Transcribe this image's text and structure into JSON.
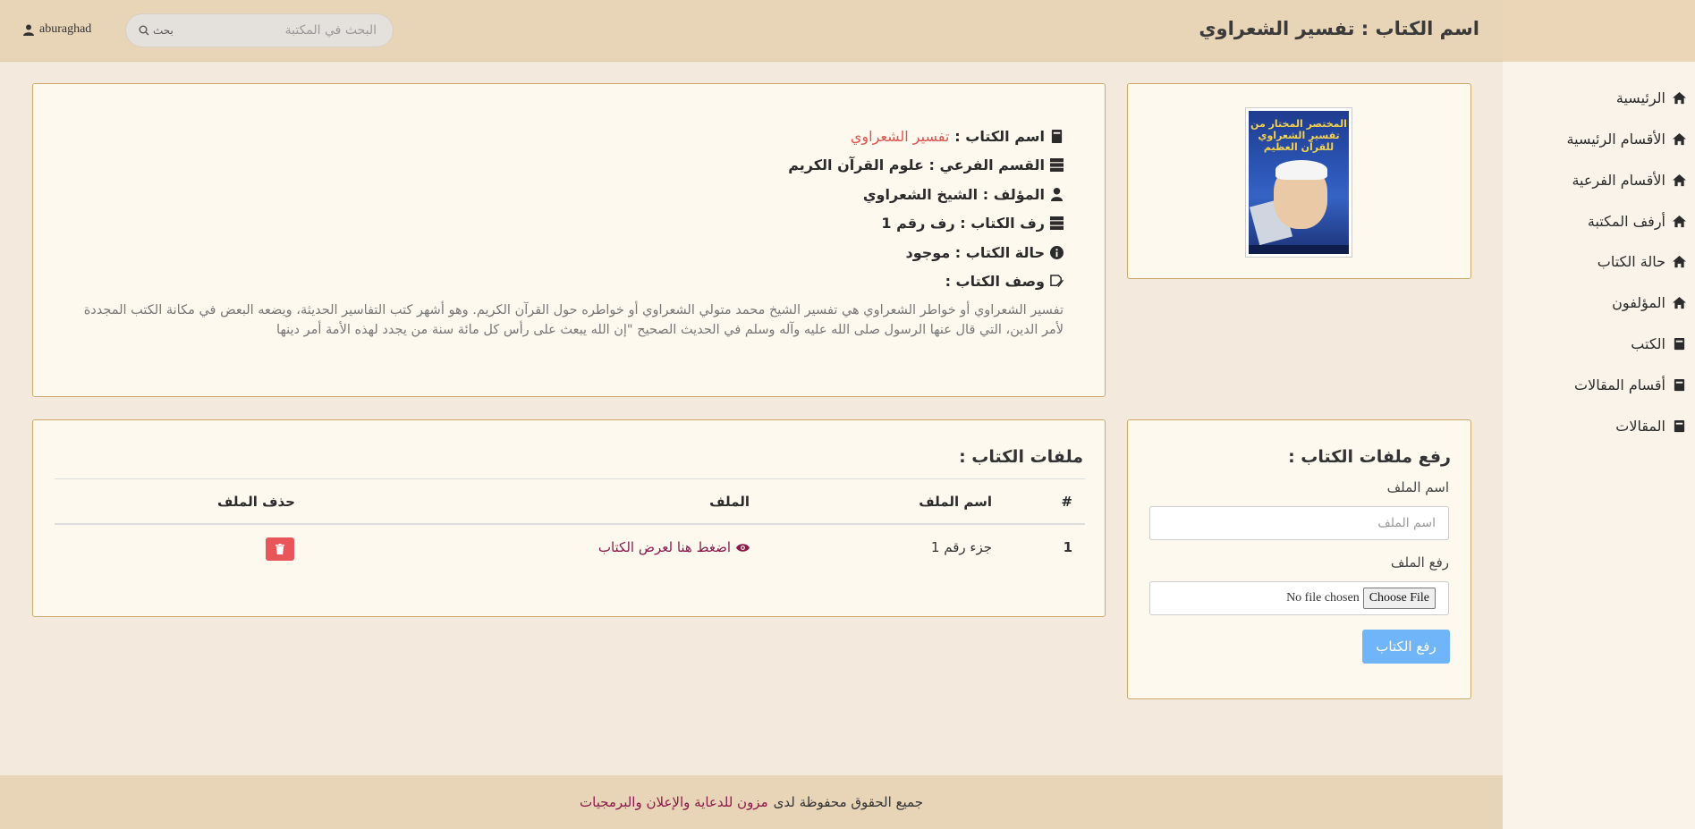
{
  "header": {
    "title": "اسم الكتاب : تفسير الشعراوي",
    "search_placeholder": "البحث في المكتبة",
    "search_button": "بحث",
    "username": "aburaghad"
  },
  "sidebar": {
    "items": [
      {
        "label": "الرئيسية",
        "icon": "home-icon"
      },
      {
        "label": "الأقسام الرئيسية",
        "icon": "home-icon"
      },
      {
        "label": "الأقسام الفرعية",
        "icon": "home-icon"
      },
      {
        "label": "أرفف المكتبة",
        "icon": "home-icon"
      },
      {
        "label": "حالة الكتاب",
        "icon": "home-icon"
      },
      {
        "label": "المؤلفون",
        "icon": "home-icon"
      },
      {
        "label": "الكتب",
        "icon": "book-icon"
      },
      {
        "label": "أقسام المقالات",
        "icon": "book-icon"
      },
      {
        "label": "المقالات",
        "icon": "book-icon"
      }
    ]
  },
  "cover": {
    "title_line1": "المختصر المختار من",
    "title_line2": "تفسير الشعراوي",
    "title_line3": "للقرآن العظيم"
  },
  "book": {
    "name_label": "اسم الكتاب :",
    "name_value": "تفسير الشعراوي",
    "subsection": "القسم الفرعي : علوم القرآن الكريم",
    "author": "المؤلف : الشيخ الشعراوي",
    "shelf": "رف الكتاب : رف رقم 1",
    "status": "حالة الكتاب : موجود",
    "description_label": "وصف الكتاب :",
    "description": "تفسير الشعراوي أو خواطر الشعراوي هي تفسير الشيخ محمد متولي الشعراوي أو خواطره حول القرآن الكريم. وهو أشهر كتب التفاسير الحديثة، ويضعه البعض في مكانة الكتب المجددة لأمر الدين، التي قال عنها الرسول صلى الله عليه وآله وسلم في الحديث الصحيح \"إن الله يبعث على رأس كل مائة سنة من يجدد لهذه الأمة أمر دينها"
  },
  "upload": {
    "heading": "رفع ملفات الكتاب :",
    "name_label": "اسم الملف",
    "name_placeholder": "اسم الملف",
    "file_label": "رفع الملف",
    "choose_button": "Choose File",
    "no_file": "No file chosen",
    "submit": "رفع الكتاب",
    "button_color": "#6fb5f7"
  },
  "files": {
    "heading": "ملفات الكتاب :",
    "columns": {
      "num": "#",
      "name": "اسم الملف",
      "file": "الملف",
      "delete": "حذف الملف"
    },
    "rows": [
      {
        "num": "1",
        "name": "جزء رقم 1",
        "link": "اضغط هنا لعرض الكتاب"
      }
    ]
  },
  "footer": {
    "text": "جميع الحقوق محفوظة لدى",
    "brand": "مزون للدعاية والإعلان والبرمجيات"
  },
  "colors": {
    "accent": "#8b1a4a",
    "highlight": "#e0524c",
    "delete": "#e8565a"
  }
}
